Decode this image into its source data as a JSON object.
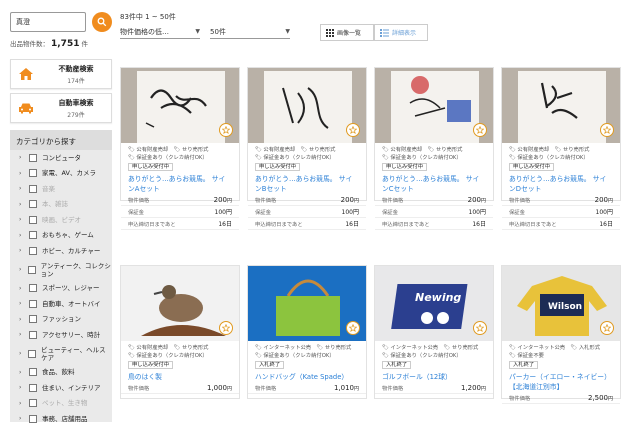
{
  "search": {
    "value": "真澄"
  },
  "listing_count": {
    "label": "出品物件数：",
    "value": "1,751",
    "unit": "件"
  },
  "nav_cards": [
    {
      "label": "不動産検索",
      "count": "174件"
    },
    {
      "label": "自動車検索",
      "count": "279件"
    }
  ],
  "categories": {
    "title": "カテゴリから探す",
    "items": [
      {
        "label": "コンピュータ"
      },
      {
        "label": "家電、AV、カメラ"
      },
      {
        "label": "音楽"
      },
      {
        "label": "本、雑誌"
      },
      {
        "label": "映画、ビデオ"
      },
      {
        "label": "おもちゃ、ゲーム"
      },
      {
        "label": "ホビー、カルチャー"
      },
      {
        "label": "アンティーク、コレクション"
      },
      {
        "label": "スポーツ、レジャー"
      },
      {
        "label": "自動車、オートバイ"
      },
      {
        "label": "ファッション"
      },
      {
        "label": "アクセサリー、時計"
      },
      {
        "label": "ビューティー、ヘルスケア"
      },
      {
        "label": "食品、飲料"
      },
      {
        "label": "住まい、インテリア"
      },
      {
        "label": "ペット、生き物"
      },
      {
        "label": "事務、店舗用品"
      }
    ]
  },
  "toolbar": {
    "result_count": "83件中 1 ~ 50件",
    "sort": "物件価格の低…",
    "per_page": "50件",
    "view_list": "画像一覧",
    "view_detail": "詳細表示"
  },
  "cards": [
    {
      "tag1": "公有財産売却",
      "tag2": "せり売形式",
      "tag3": "保証金あり（クレカ納付OK）",
      "badge": "申し込み受付中",
      "title": "ありがとう…あらお競馬。 サインAセット",
      "price_label": "物件価格",
      "price": "200",
      "deposit_label": "保証金",
      "deposit": "100円",
      "deadline_label": "申込締切日まであと",
      "deadline": "16日",
      "photo": "sign-a"
    },
    {
      "tag1": "公有財産売却",
      "tag2": "せり売形式",
      "tag3": "保証金あり（クレカ納付OK）",
      "badge": "申し込み受付中",
      "title": "ありがとう…あらお競馬。 サインBセット",
      "price_label": "物件価格",
      "price": "200",
      "deposit_label": "保証金",
      "deposit": "100円",
      "deadline_label": "申込締切日まであと",
      "deadline": "16日",
      "photo": "sign-b"
    },
    {
      "tag1": "公有財産売却",
      "tag2": "せり売形式",
      "tag3": "保証金あり（クレカ納付OK）",
      "badge": "申し込み受付中",
      "title": "ありがとう…あらお競馬。 サインCセット",
      "price_label": "物件価格",
      "price": "200",
      "deposit_label": "保証金",
      "deposit": "100円",
      "deadline_label": "申込締切日まであと",
      "deadline": "16日",
      "photo": "sign-c"
    },
    {
      "tag1": "公有財産売却",
      "tag2": "せり売形式",
      "tag3": "保証金あり（クレカ納付OK）",
      "badge": "申し込み受付中",
      "title": "ありがとう…あらお競馬。 サインDセット",
      "price_label": "物件価格",
      "price": "200",
      "deposit_label": "保証金",
      "deposit": "100円",
      "deadline_label": "申込締切日まであと",
      "deadline": "16日",
      "photo": "sign-d"
    },
    {
      "tag1": "公有財産売却",
      "tag2": "せり売形式",
      "tag3": "保証金あり（クレカ納付OK）",
      "badge": "申し込み受付中",
      "title": "鳥のはく製",
      "price_label": "物件価格",
      "price": "1,000",
      "photo": "bird"
    },
    {
      "tag1": "インターネット公売",
      "tag2": "せり売形式",
      "tag3": "保証金あり（クレカ納付OK）",
      "badge": "入札終了",
      "title": "ハンドバッグ（Kate Spade）",
      "price_label": "物件価格",
      "price": "1,010",
      "photo": "bag"
    },
    {
      "tag1": "インターネット公売",
      "tag2": "せり売形式",
      "tag3": "保証金あり（クレカ納付OK）",
      "badge": "入札終了",
      "title": "ゴルフボール（12球）",
      "price_label": "物件価格",
      "price": "1,200",
      "photo": "golf"
    },
    {
      "tag1": "インターネット公売",
      "tag2": "入札形式",
      "tag3": "保証金不要",
      "badge": "入札終了",
      "title": "パーカー（イエロー・ネイビー）【北海道江別市】",
      "price_label": "物件価格",
      "price": "2,500",
      "photo": "hoodie"
    }
  ],
  "colors": {
    "accent": "#f08c1e",
    "link": "#2a7fd6"
  }
}
